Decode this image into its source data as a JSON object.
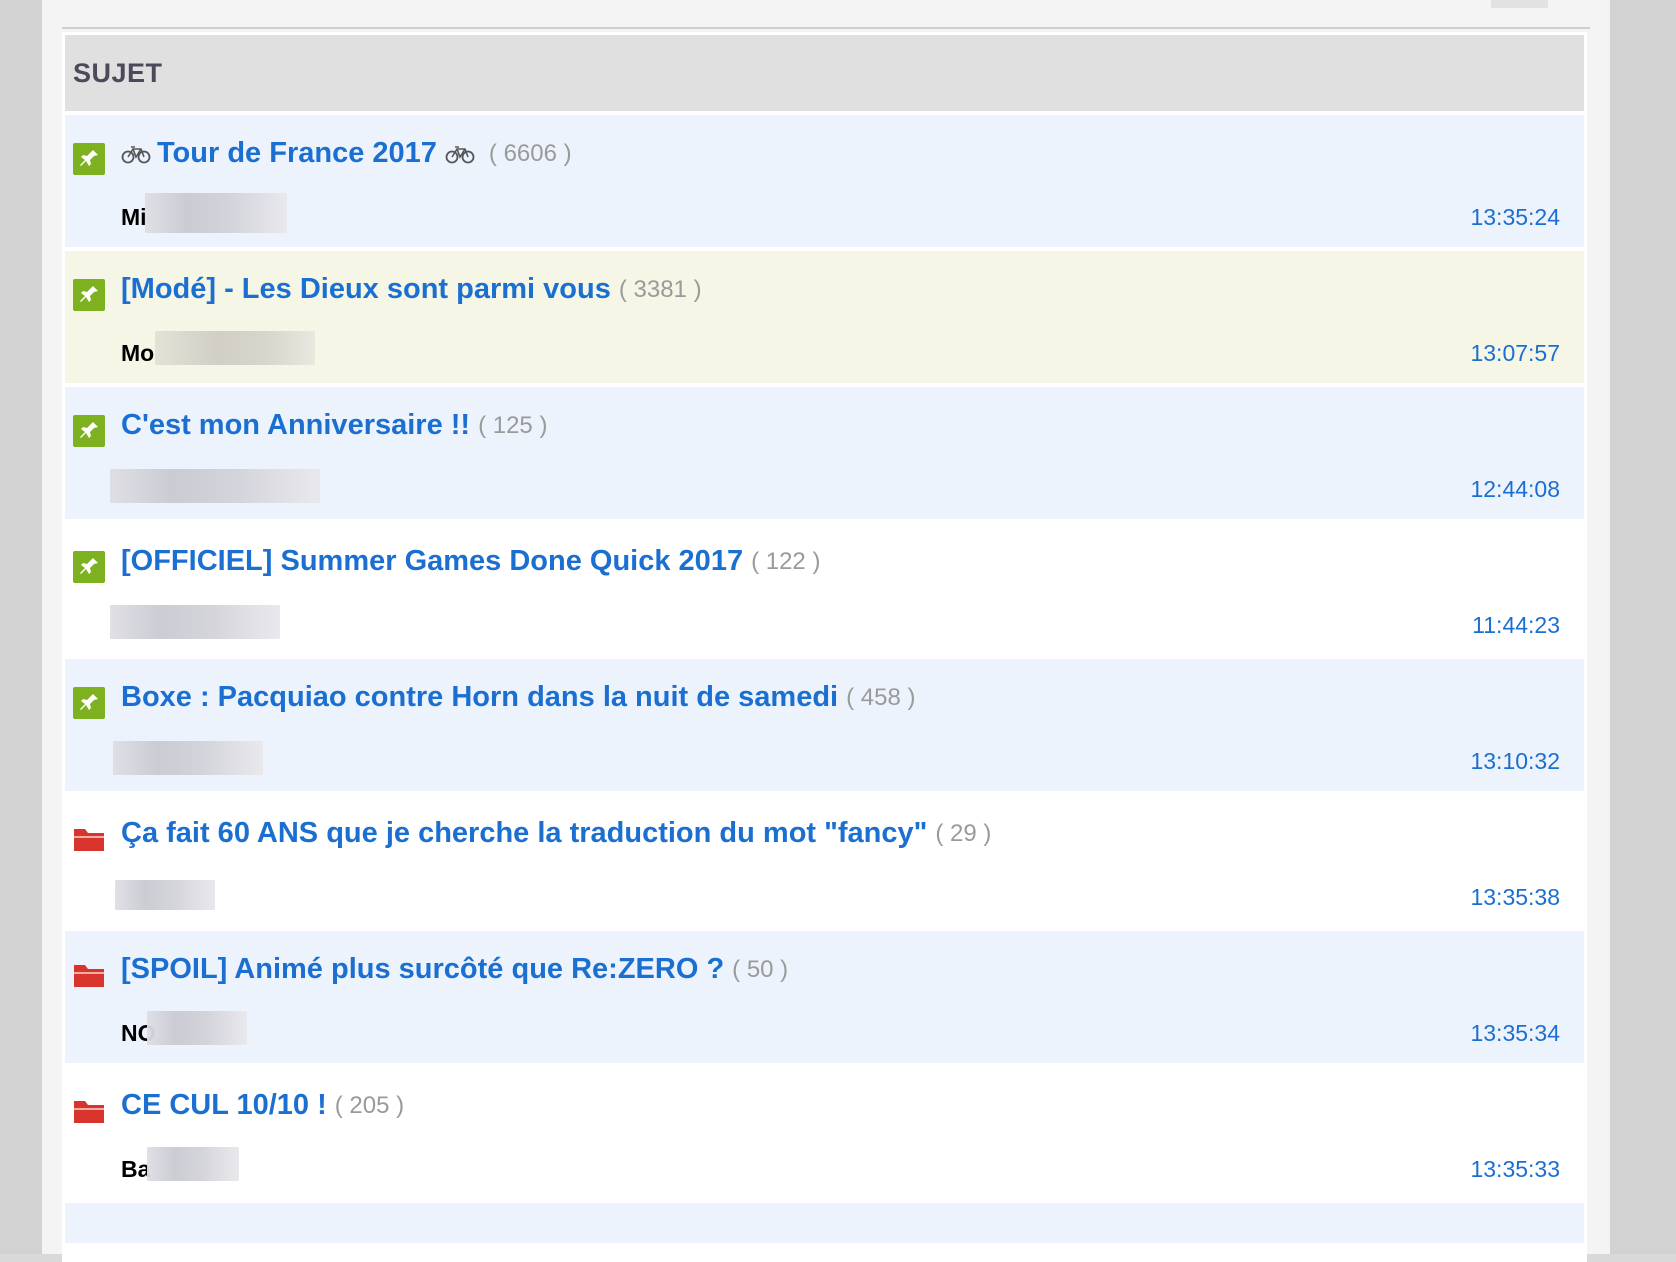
{
  "header": {
    "subject_label": "SUJET"
  },
  "topics": [
    {
      "type": "pinned",
      "bg": "blue",
      "bike": true,
      "title": "Tour de France 2017",
      "count": "( 6606 )",
      "author": "Mi",
      "time": "13:35:24"
    },
    {
      "type": "pinned",
      "bg": "yellow",
      "bike": false,
      "title": "[Modé] - Les Dieux sont parmi vous",
      "count": "( 3381 )",
      "author": "Mo",
      "time": "13:07:57"
    },
    {
      "type": "pinned",
      "bg": "blue",
      "bike": false,
      "title": "C'est mon Anniversaire !!",
      "count": "( 125 )",
      "author": "",
      "time": "12:44:08"
    },
    {
      "type": "pinned",
      "bg": "white",
      "bike": false,
      "title": "[OFFICIEL] Summer Games Done Quick 2017",
      "count": "( 122 )",
      "author": "",
      "time": "11:44:23"
    },
    {
      "type": "pinned",
      "bg": "blue",
      "bike": false,
      "title": "Boxe : Pacquiao contre Horn dans la nuit de samedi",
      "count": "( 458 )",
      "author": "",
      "time": "13:10:32"
    },
    {
      "type": "folder",
      "bg": "white",
      "bike": false,
      "title": "Ça fait 60 ANS que je cherche la traduction du mot \"fancy\"",
      "count": "( 29 )",
      "author": "",
      "time": "13:35:38"
    },
    {
      "type": "folder",
      "bg": "blue",
      "bike": false,
      "title": "[SPOIL] Animé plus surcôté que Re:ZERO ?",
      "count": "( 50 )",
      "author": "NO",
      "time": "13:35:34"
    },
    {
      "type": "folder",
      "bg": "white",
      "bike": false,
      "title": "CE CUL 10/10 !",
      "count": "( 205 )",
      "author": "Ba",
      "time": "13:35:33"
    }
  ],
  "colors": {
    "link": "#1a6fd0",
    "pin": "#7db11f",
    "folder": "#d9342b"
  }
}
